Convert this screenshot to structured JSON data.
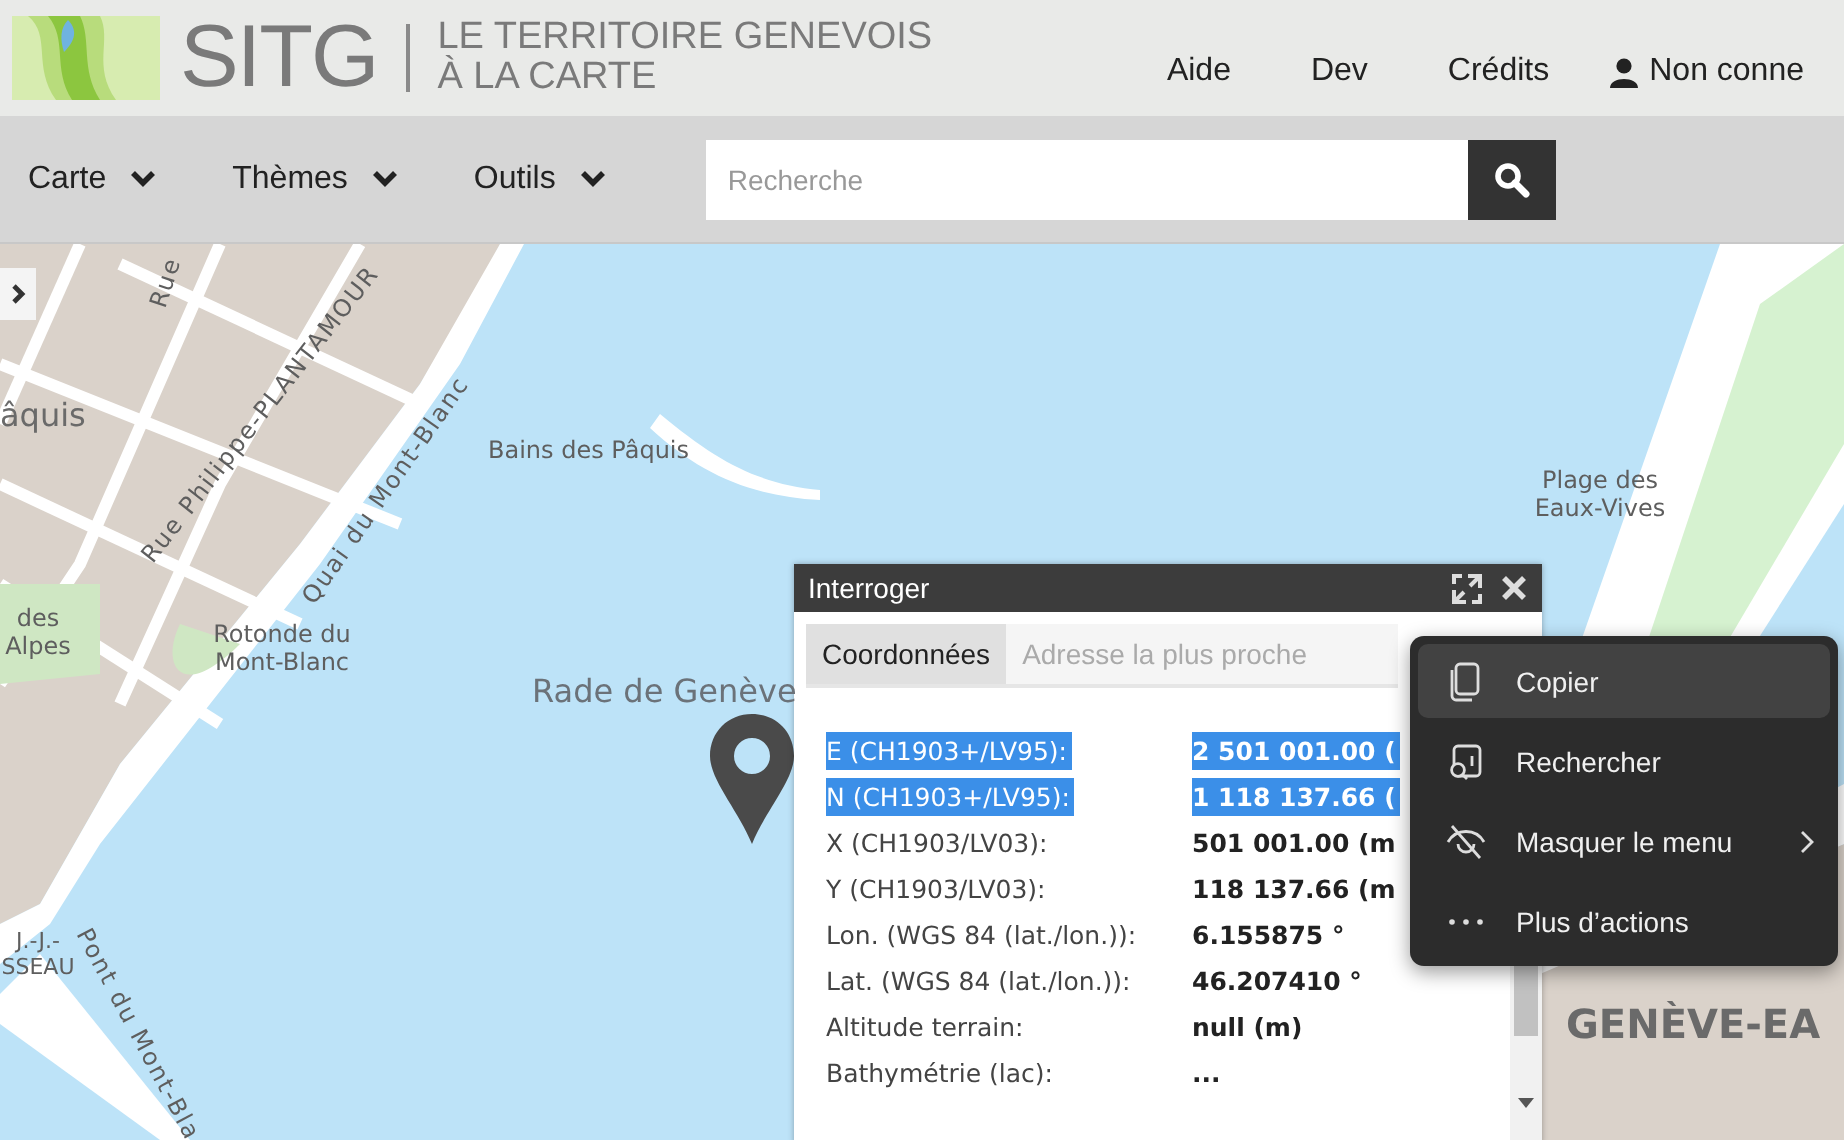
{
  "header": {
    "logo_text": "SITG",
    "tagline": [
      "LE TERRITOIRE GENEVOIS",
      "À LA CARTE"
    ],
    "nav": [
      "Aide",
      "Dev",
      "Crédits"
    ],
    "user": "Non conne"
  },
  "toolbar": {
    "menus": [
      "Carte",
      "Thèmes",
      "Outils"
    ],
    "search": {
      "placeholder": "Recherche"
    }
  },
  "map": {
    "labels": [
      {
        "text": "Rue",
        "kind": "street"
      },
      {
        "text": "âquis",
        "kind": "district"
      },
      {
        "text": "Rue Philippe-PLANTAMOUR",
        "kind": "street"
      },
      {
        "text": "Quai du Mont-Blanc",
        "kind": "street"
      },
      {
        "text": "Bains des Pâquis",
        "kind": "place"
      },
      {
        "text": "Plage des Eaux-Vives",
        "kind": "place"
      },
      {
        "text": "des Alpes",
        "kind": "place"
      },
      {
        "text": "Rotonde du Mont-Blanc",
        "kind": "place"
      },
      {
        "text": "Rade de Genève",
        "kind": "water"
      },
      {
        "text": "J.-J.- SSEAU",
        "kind": "place"
      },
      {
        "text": "Pont du Mont-Bla",
        "kind": "street"
      },
      {
        "text": "GENÈVE-EA",
        "kind": "district"
      }
    ]
  },
  "popup": {
    "title": "Interroger",
    "tabs": [
      {
        "label": "Coordonnées",
        "selected": true
      },
      {
        "label": "Adresse la plus proche",
        "selected": false
      }
    ],
    "rows": [
      {
        "label": "E (CH1903+/LV95):",
        "value": "2 501 001.00 (",
        "selected": true
      },
      {
        "label": "N (CH1903+/LV95):",
        "value": "1 118 137.66 (",
        "selected": true
      },
      {
        "label": "X (CH1903/LV03):",
        "value": "501 001.00 (m",
        "selected": false
      },
      {
        "label": "Y (CH1903/LV03):",
        "value": "118 137.66 (m",
        "selected": false
      },
      {
        "label": "Lon. (WGS 84 (lat./lon.)):",
        "value": "6.155875 °",
        "selected": false
      },
      {
        "label": "Lat. (WGS 84 (lat./lon.)):",
        "value": "46.207410 °",
        "selected": false
      },
      {
        "label": "Altitude terrain:",
        "value": "null (m)",
        "selected": false
      },
      {
        "label": "Bathymétrie (lac):",
        "value": "...",
        "selected": false
      }
    ]
  },
  "context_menu": {
    "items": [
      {
        "label": "Copier",
        "kind": "copy",
        "selected": true,
        "submenu": false
      },
      {
        "label": "Rechercher",
        "kind": "search",
        "selected": false,
        "submenu": false
      },
      {
        "label": "Masquer le menu",
        "kind": "hide",
        "selected": false,
        "submenu": true
      },
      {
        "label": "Plus d’actions",
        "kind": "more",
        "selected": false,
        "submenu": false
      }
    ]
  }
}
